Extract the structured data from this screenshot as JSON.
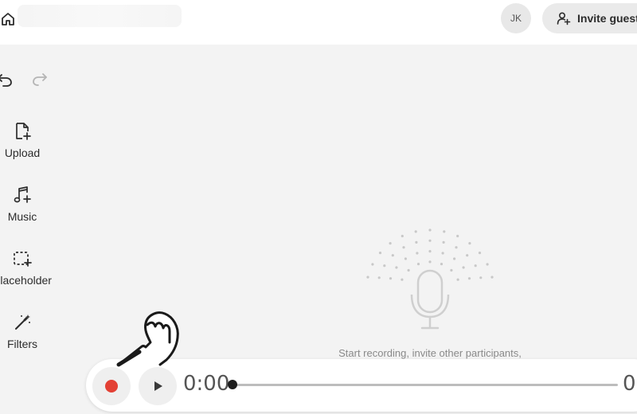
{
  "header": {
    "avatar_initials": "JK",
    "invite_label": "Invite guests"
  },
  "sidebar": {
    "tools": [
      {
        "label": "Upload",
        "icon": "file-plus-icon"
      },
      {
        "label": "Music",
        "icon": "music-plus-icon"
      },
      {
        "label": "Placeholder",
        "icon": "dashed-square-plus-icon"
      },
      {
        "label": "Filters",
        "icon": "magic-wand-icon"
      }
    ]
  },
  "empty_state": {
    "text": "Start recording, invite other participants,"
  },
  "transport": {
    "current_time": "0:00",
    "end_time": "0",
    "progress": 0,
    "record_color": "#e34034"
  }
}
